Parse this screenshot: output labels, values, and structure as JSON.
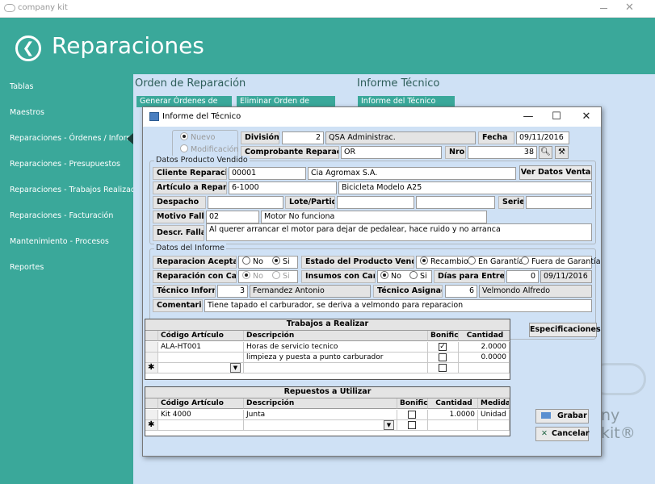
{
  "window": {
    "title": "company kit"
  },
  "header": {
    "back_icon": "arrow-left-circle-icon",
    "title": "Reparaciones"
  },
  "sidebar": {
    "items": [
      {
        "label": "Tablas"
      },
      {
        "label": "Maestros"
      },
      {
        "label": "Reparaciones - Órdenes / Informe"
      },
      {
        "label": "Reparaciones - Presupuestos"
      },
      {
        "label": "Reparaciones - Trabajos Realizados"
      },
      {
        "label": "Reparaciones - Facturación"
      },
      {
        "label": "Mantenimiento - Procesos"
      },
      {
        "label": "Reportes"
      }
    ],
    "active_index": 2
  },
  "content": {
    "orden_title": "Orden de Reparación",
    "informe_title": "Informe Técnico",
    "btn_generar": "Generar Órdenes de",
    "btn_eliminar": "Eliminar Orden de",
    "btn_informe": "Informe del Técnico",
    "brand": "ny kit®"
  },
  "dialog": {
    "title": "Informe del Técnico",
    "radio_nuevo": "Nuevo",
    "radio_modificacion": "Modificación",
    "division_label": "División",
    "division_code": "2",
    "division_name": "QSA Administrac.",
    "fecha_label": "Fecha",
    "fecha_value": "09/11/2016",
    "comprobante_label": "Comprobante Reparación",
    "comprobante_value": "OR",
    "nro_label": "Nro.",
    "nro_value": "38",
    "grp_producto": "Datos Producto Vendido",
    "cliente_label": "Cliente Reparación",
    "cliente_code": "00001",
    "cliente_name": "Cia Agromax S.A.",
    "ver_datos_btn": "Ver Datos Venta",
    "articulo_label": "Artículo a Reparar",
    "articulo_code": "6-1000",
    "articulo_name": "Bicicleta Modelo A25",
    "despacho_label": "Despacho",
    "lote_label": "Lote/Partida",
    "serie_label": "Serie",
    "motivo_label": "Motivo Falla",
    "motivo_code": "02",
    "motivo_name": "Motor No funciona",
    "descr_label": "Descr. Falla",
    "descr_value": "Al querer arrancar el motor para dejar de pedalear, hace ruido y no arranca",
    "grp_informe": "Datos del Informe",
    "rep_aceptada_label": "Reparacion Aceptada",
    "no": "No",
    "si": "Si",
    "estado_label": "Estado del Producto Vendido",
    "recambio": "Recambio",
    "en_garantia": "En Garantía",
    "fuera_garantia": "Fuera de Garantía",
    "rep_cargo_label": "Reparación con Cargo",
    "insumos_label": "Insumos con Cargo",
    "dias_label": "Días para Entrega",
    "dias_value": "0",
    "entrega_fecha": "09/11/2016",
    "tecnico_informe_label": "Técnico Informe",
    "tecnico_informe_code": "3",
    "tecnico_informe_name": "Fernandez Antonio",
    "tecnico_asignado_label": "Técnico Asignado",
    "tecnico_asignado_code": "6",
    "tecnico_asignado_name": "Velmondo Alfredo",
    "comentario_label": "Comentario",
    "comentario_value": "Tiene tapado el carburador, se deriva a velmondo para reparacion",
    "trabajos_title": "Trabajos a Realizar",
    "especificaciones_btn": "Especificaciones",
    "trabajos_cols": [
      "Código Artículo",
      "Descripción",
      "Bonific.",
      "Cantidad"
    ],
    "trabajos_rows": [
      {
        "codigo": "ALA-HT001",
        "descripcion": "Horas de servicio tecnico",
        "bonif": true,
        "cantidad": "2.0000"
      },
      {
        "codigo": "",
        "descripcion": "limpieza y puesta a punto carburador",
        "bonif": false,
        "cantidad": "0.0000"
      }
    ],
    "repuestos_title": "Repuestos a Utilizar",
    "repuestos_cols": [
      "Código Artículo",
      "Descripción",
      "Bonific.",
      "Cantidad",
      "Medida"
    ],
    "repuestos_rows": [
      {
        "codigo": "Kit 4000",
        "descripcion": "Junta",
        "bonif": false,
        "cantidad": "1.0000",
        "medida": "Unidad"
      }
    ],
    "new_row_marker": "✱",
    "grabar_btn": "Grabar",
    "cancelar_btn": "Cancelar"
  }
}
